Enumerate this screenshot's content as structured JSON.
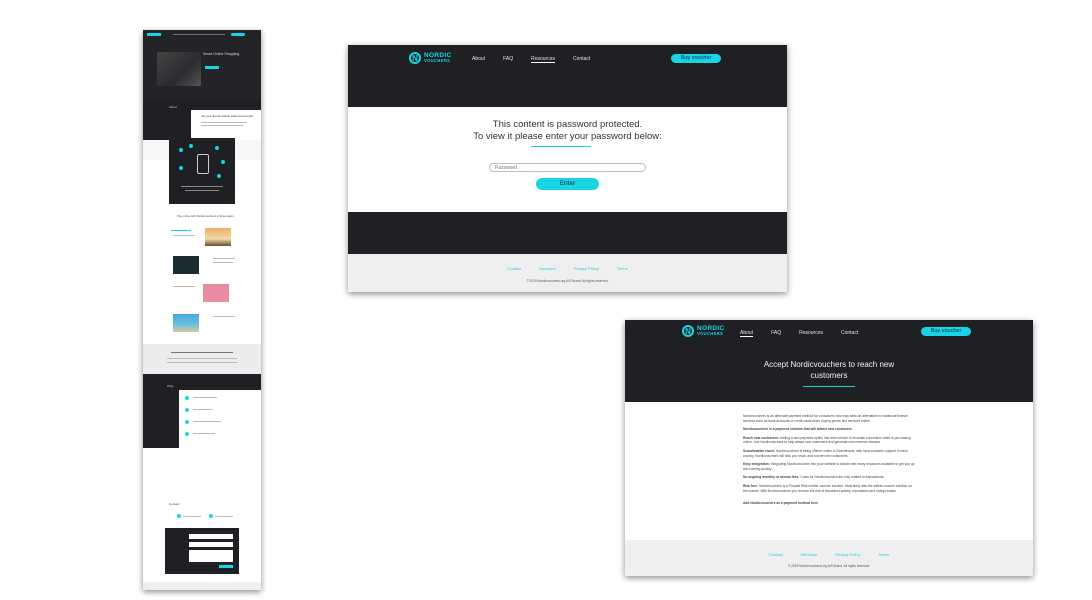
{
  "brand": {
    "name_line1": "NORDIC",
    "name_line2": "VOUCHERS",
    "accent": "#19d3e6",
    "dark": "#1f2024"
  },
  "password_page": {
    "nav": {
      "about": "About",
      "faq": "FAQ",
      "resources": "Resources",
      "contact": "Contact",
      "buy": "Buy voucher"
    },
    "message_line1": "This content is password protected.",
    "message_line2": "To view it please enter your password below:",
    "password_placeholder": "Password",
    "enter_label": "Enter",
    "footer": {
      "contact": "Contact",
      "merchant": "Merchant",
      "privacy": "Privacy Policy",
      "terms": "Terms",
      "copyright": "© 2019 Nordicvouchers.org A/S Brand. All rights reserved."
    }
  },
  "about_page": {
    "nav": {
      "about": "About",
      "faq": "FAQ",
      "resources": "Resources",
      "contact": "Contact",
      "buy": "Buy voucher"
    },
    "hero_line1": "Accept Nordicvouchers to reach new",
    "hero_line2": "customers",
    "paragraphs": [
      {
        "bold": "",
        "text": "Nordicvouchers is an alternate payment method for consumers who may seek an alternative to traditional finance services such as bank accounts or credit cards when buying goods and services online."
      },
      {
        "bold": "Nordicvouchers is a payment solution that will attract new customers",
        "text": ""
      },
      {
        "bold": "Reach new customers:",
        "text": " Adding a new payment option has been shown to increase conversion rates in purchasing online. Use Nordicvouchers to help attract new customers and generate new revenue streams."
      },
      {
        "bold": "Scandinavian reach:",
        "text": " Nordicvouchers is being offered online in Scandinavia, with local customer support in each country. Nordicvouchers will help you reach and convert new customers."
      },
      {
        "bold": "Easy integration:",
        "text": " Integrating Nordicvouchers into your website is simple with many resources available to get you up and running quickly."
      },
      {
        "bold": "No ongoing monthly or annual fees:",
        "text": " Costs for Nordicvouchers are only related to transactions."
      },
      {
        "bold": "Risk free:",
        "text": " Nordicvouchers is a Prepaid Risk mobile voucher solution. Most likely also the safest voucher solution on the market. With Nordicvouchers you remove the risk of fraudulent activity, repudiation and charge-backs."
      },
      {
        "bold": "Add Nordicvouchers as a payment method here",
        "text": ""
      }
    ],
    "footer": {
      "contact": "Contact",
      "merchant": "Merchant",
      "privacy": "Privacy Policy",
      "terms": "Terms",
      "copyright": "© 2019 Nordicvouchers.org A/S Brand. All rights reserved."
    }
  },
  "long_page": {
    "hero_title": "Smart Online Shopping",
    "about_label": "About",
    "about_heading": "Use your favorite website safely and securely",
    "how_heading": "Pay online with Nordicvouchers in three steps",
    "faq_label": "FAQ",
    "contact_label": "Contact"
  }
}
